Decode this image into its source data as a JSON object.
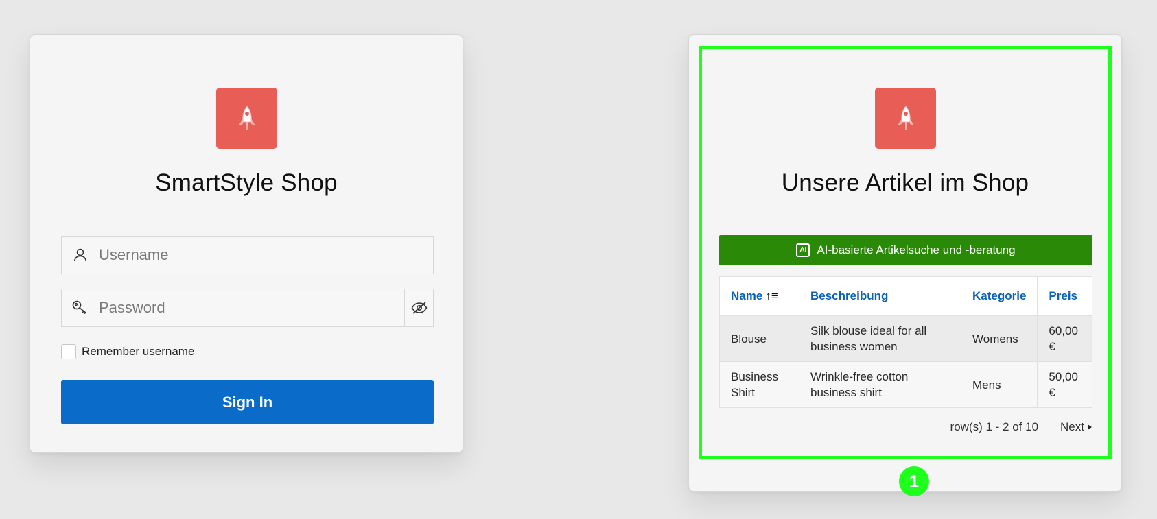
{
  "login": {
    "title": "SmartStyle Shop",
    "username_placeholder": "Username",
    "password_placeholder": "Password",
    "remember_label": "Remember username",
    "signin_label": "Sign In"
  },
  "shop": {
    "title": "Unsere Artikel im Shop",
    "ai_button_label": "AI-basierte Artikelsuche und -beratung",
    "ai_icon_text": "AI",
    "columns": [
      "Name",
      "Beschreibung",
      "Kategorie",
      "Preis"
    ],
    "rows": [
      [
        "Blouse",
        "Silk blouse ideal for all business women",
        "Womens",
        "60,00 €"
      ],
      [
        "Business Shirt",
        "Wrinkle-free cotton business shirt",
        "Mens",
        "50,00 €"
      ]
    ],
    "pagination_text": "row(s) 1 - 2 of 10",
    "next_label": "Next",
    "marker_label": "1"
  },
  "colors": {
    "logo": "#e85d55",
    "signin": "#0a6bc8",
    "ai_button": "#2a8a08",
    "highlight": "#1eff1e",
    "link": "#0a62b8"
  },
  "icons": [
    "rocket-icon",
    "user-icon",
    "key-icon",
    "eye-slash-icon",
    "ai-icon",
    "sort-asc-icon",
    "caret-right-icon"
  ]
}
